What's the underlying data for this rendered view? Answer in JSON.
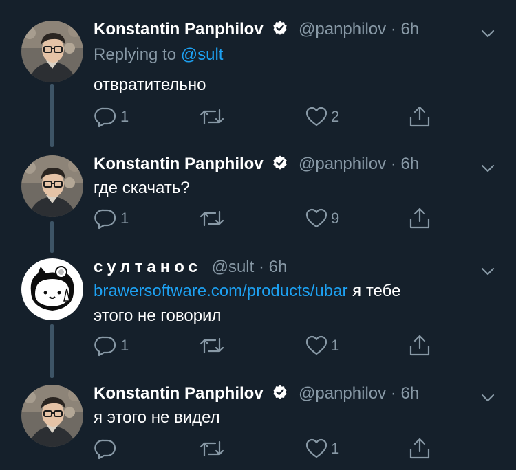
{
  "colors": {
    "background": "#15202b",
    "text": "#ffffff",
    "muted": "#8899a6",
    "link": "#1da1f2",
    "verified": "#ffffff"
  },
  "icons": [
    "reply-icon",
    "retweet-icon",
    "like-icon",
    "share-icon",
    "verified-icon",
    "chevron-down-icon"
  ],
  "tweets": [
    {
      "name": "Konstantin Panphilov",
      "handle": "@panphilov",
      "separator": "·",
      "time": "6h",
      "replying_prefix": "Replying to",
      "replying_handle": "@sult",
      "text": "отвратительно",
      "reply_count": "1",
      "retweet_count": "",
      "like_count": "2"
    },
    {
      "name": "Konstantin Panphilov",
      "handle": "@panphilov",
      "separator": "·",
      "time": "6h",
      "text": "где скачать?",
      "reply_count": "1",
      "retweet_count": "",
      "like_count": "9"
    },
    {
      "name": "султанос",
      "handle": "@sult",
      "separator": "·",
      "time": "6h",
      "link": "brawersoftware.com/products/ubar",
      "text_after_link": " я тебе",
      "text_line2": "этого не говорил",
      "reply_count": "1",
      "retweet_count": "",
      "like_count": "1"
    },
    {
      "name": "Konstantin Panphilov",
      "handle": "@panphilov",
      "separator": "·",
      "time": "6h",
      "text": "я этого не видел",
      "reply_count": "",
      "retweet_count": "",
      "like_count": "1"
    }
  ]
}
